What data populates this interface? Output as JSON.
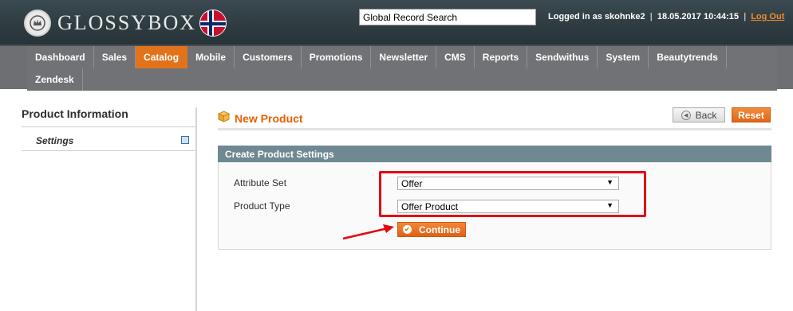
{
  "header": {
    "brand": "GLOSSYBOX",
    "search_value": "Global Record Search",
    "logged_in": "Logged in as skohnke2",
    "datetime": "18.05.2017 10:44:15",
    "logout": "Log Out"
  },
  "nav": {
    "row1": [
      "Dashboard",
      "Sales",
      "Catalog",
      "Mobile",
      "Customers",
      "Promotions",
      "Newsletter",
      "CMS",
      "Reports",
      "Sendwithus",
      "System",
      "Beautytrends"
    ],
    "row2": [
      "Zendesk"
    ],
    "active": "Catalog"
  },
  "sidebar": {
    "title": "Product Information",
    "item": "Settings"
  },
  "main": {
    "title": "New Product",
    "back_label": "Back",
    "reset_label": "Reset",
    "section_title": "Create Product Settings",
    "attribute_set_label": "Attribute Set",
    "attribute_set_value": "Offer",
    "product_type_label": "Product Type",
    "product_type_value": "Offer Product",
    "continue_label": "Continue"
  },
  "colors": {
    "accent": "#e2731a",
    "highlight": "#e30613",
    "section_header": "#6f8992"
  }
}
